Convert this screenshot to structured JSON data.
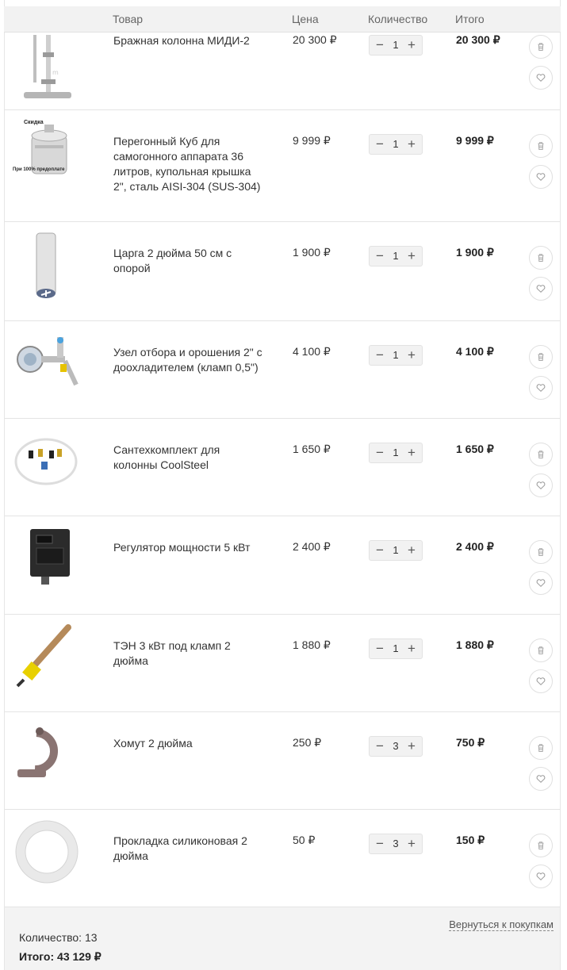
{
  "header": {
    "col_product": "Товар",
    "col_price": "Цена",
    "col_quantity": "Количество",
    "col_total": "Итого"
  },
  "items": [
    {
      "name": "Бражная колонна МИДИ-2",
      "price": "20 300 ₽",
      "qty": "1",
      "total": "20 300 ₽",
      "image": "column-still-image"
    },
    {
      "name": "Перегонный Куб для самогонного аппарата 36 литров, купольная крышка 2\", сталь AISI-304 (SUS-304)",
      "price": "9 999 ₽",
      "qty": "1",
      "total": "9 999 ₽",
      "image": "distillation-tank-image",
      "badge_top": "Скидка",
      "badge_bottom": "При 100% предоплате"
    },
    {
      "name": "Царга 2 дюйма 50 см с опорой",
      "price": "1 900 ₽",
      "qty": "1",
      "total": "1 900 ₽",
      "image": "tube-section-image"
    },
    {
      "name": "Узел отбора и орошения 2\" с доохладителем (кламп 0,5\")",
      "price": "4 100 ₽",
      "qty": "1",
      "total": "4 100 ₽",
      "image": "reflux-unit-image"
    },
    {
      "name": "Сантехкомплект для колонны CoolSteel",
      "price": "1 650 ₽",
      "qty": "1",
      "total": "1 650 ₽",
      "image": "plumbing-kit-image"
    },
    {
      "name": "Регулятор мощности 5 кВт",
      "price": "2 400 ₽",
      "qty": "1",
      "total": "2 400 ₽",
      "image": "power-regulator-image"
    },
    {
      "name": "ТЭН 3 кВт под кламп 2 дюйма",
      "price": "1 880 ₽",
      "qty": "1",
      "total": "1 880 ₽",
      "image": "heating-element-image"
    },
    {
      "name": "Хомут 2 дюйма",
      "price": "250 ₽",
      "qty": "3",
      "total": "750 ₽",
      "image": "clamp-image"
    },
    {
      "name": "Прокладка силиконовая 2 дюйма",
      "price": "50 ₽",
      "qty": "3",
      "total": "150 ₽",
      "image": "silicone-gasket-image"
    }
  ],
  "controls": {
    "minus": "−",
    "plus": "+"
  },
  "footer": {
    "count": "Количество: 13",
    "sum": "Итого: 43 129 ₽",
    "back_link": "Вернуться к покупкам"
  },
  "colors": {
    "header_bg": "#f2f2f2",
    "footer_bg": "#f3f3f3",
    "border": "#e4e4e4"
  }
}
